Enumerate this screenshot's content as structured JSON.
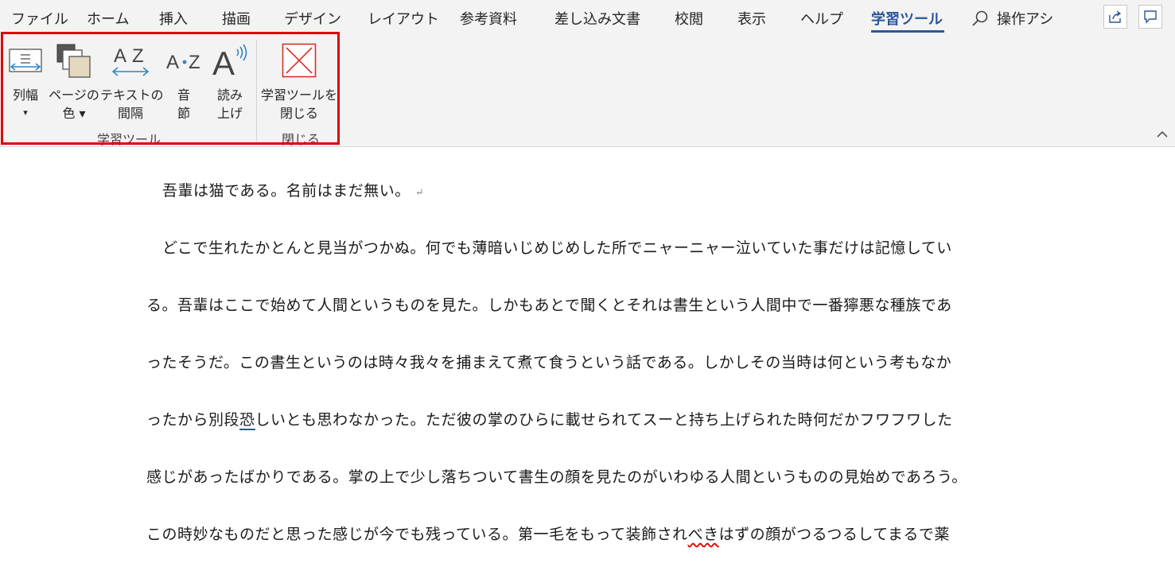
{
  "tabs": [
    {
      "label": "ファイル",
      "active": false
    },
    {
      "label": "ホーム",
      "active": false
    },
    {
      "label": "挿入",
      "active": false
    },
    {
      "label": "描画",
      "active": false
    },
    {
      "label": "デザイン",
      "active": false
    },
    {
      "label": "レイアウト",
      "active": false
    },
    {
      "label": "参考資料",
      "active": false
    },
    {
      "label": "差し込み文書",
      "active": false
    },
    {
      "label": "校閲",
      "active": false
    },
    {
      "label": "表示",
      "active": false
    },
    {
      "label": "ヘルプ",
      "active": false
    },
    {
      "label": "学習ツール",
      "active": true
    }
  ],
  "search": {
    "label": "操作アシ",
    "icon": "search-icon"
  },
  "top_buttons": [
    {
      "icon": "share-icon"
    },
    {
      "icon": "comments-icon"
    }
  ],
  "ribbon": {
    "column_width": {
      "line1": "列幅",
      "line2": "▾",
      "icon": "column-width-icon"
    },
    "page_color": {
      "line1": "ページの",
      "line2": "色 ▾",
      "icon": "page-color-icon"
    },
    "text_spacing": {
      "line1": "テキストの",
      "line2": "間隔",
      "icon": "text-spacing-icon"
    },
    "syllables": {
      "line1": "音",
      "line2": "節",
      "icon": "syllables-icon"
    },
    "read_aloud": {
      "line1": "読み",
      "line2": "上げ",
      "icon": "read-aloud-icon"
    },
    "close_tools": {
      "line1": "学習ツールを",
      "line2": "閉じる",
      "icon": "close-icon"
    },
    "group_learning": "学習ツール",
    "group_close": "閉じる"
  },
  "colors": {
    "accent": "#2b579a",
    "highlight": "#e00000",
    "ribbon_bg": "#f3f3f3"
  },
  "document": {
    "line1": "吾輩は猫である。名前はまだ無い。",
    "para_mark": "↵",
    "line2": "どこで生れたかとんと見当がつかぬ。何でも薄暗いじめじめした所でニャーニャー泣いていた事だけは記憶してい",
    "line3": "る。吾輩はここで始めて人間というものを見た。しかもあとで聞くとそれは書生という人間中で一番獰悪な種族であ",
    "line4": "ったそうだ。この書生というのは時々我々を捕まえて煮て食うという話である。しかしその当時は何という考もなか",
    "line5a": "ったから別段",
    "line5b": "恐",
    "line5c": "しいとも思わなかった。ただ彼の掌のひらに載せられてスーと持ち上げられた時何だかフワフワした",
    "line6": "感じがあったばかりである。掌の上で少し落ちついて書生の顔を見たのがいわゆる人間というものの見始めであろう。",
    "line7a": "この時妙なものだと思った感じが今でも残っている。第一毛をもって装飾され",
    "line7b": "べき",
    "line7c": "はずの顔がつるつるしてまるで薬"
  }
}
